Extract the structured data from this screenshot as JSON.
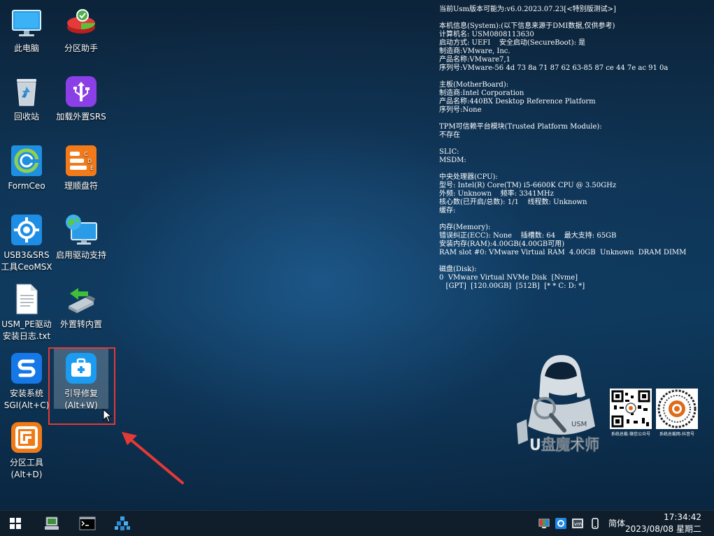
{
  "desktop": {
    "icons": [
      {
        "label1": "此电脑",
        "label2": ""
      },
      {
        "label1": "分区助手",
        "label2": ""
      },
      {
        "label1": "回收站",
        "label2": ""
      },
      {
        "label1": "加载外置SRS",
        "label2": ""
      },
      {
        "label1": "FormCeo",
        "label2": ""
      },
      {
        "label1": "理顺盘符",
        "label2": ""
      },
      {
        "label1": "USB3&SRS",
        "label2": "工具CeoMSX"
      },
      {
        "label1": "启用驱动支持",
        "label2": ""
      },
      {
        "label1": "USM_PE驱动",
        "label2": "安装日志.txt"
      },
      {
        "label1": "外置转内置",
        "label2": ""
      },
      {
        "label1": "安装系统",
        "label2": "SGI(Alt+C)"
      },
      {
        "label1": "引导修复",
        "label2": "(Alt+W)"
      },
      {
        "label1": "分区工具",
        "label2": "(Alt+D)"
      }
    ],
    "selected_icon": "引导修复"
  },
  "sysinfo": {
    "lines": [
      "当前Usm版本可能为:v6.0.2023.07.23[<特别版测试>]",
      "",
      "本机信息(System):(以下信息来源于DMI数据,仅供参考)",
      "计算机名: USM0808113630",
      "启动方式: UEFI    安全启动(SecureBoot): 是",
      "制造商:VMware, Inc.",
      "产品名称:VMware7,1",
      "序列号:VMware-56 4d 73 8a 71 87 62 63-85 87 ce 44 7e ac 91 0a",
      "",
      "主板(MotherBoard):",
      "制造商:Intel Corporation",
      "产品名称:440BX Desktop Reference Platform",
      "序列号:None",
      "",
      "TPM可信赖平台模块(Trusted Platform Module):",
      "不存在",
      "",
      "SLIC:",
      "MSDM:",
      "",
      "中央处理器(CPU):",
      "型号: Intel(R) Core(TM) i5-6600K CPU @ 3.50GHz",
      "外频: Unknown    频率: 3341MHz",
      "核心数(已开启/总数): 1/1    线程数: Unknown",
      "缓存:",
      "",
      "内存(Memory):",
      "错误纠正(ECC): None    插槽数: 64    最大支持: 65GB",
      "安装内存(RAM):4.00GB(4.00GB可用)",
      "RAM slot #0: VMware Virtual RAM  4.00GB  Unknown  DRAM DIMM",
      "",
      "磁盘(Disk):",
      "0  VMware Virtual NVMe Disk  [Nvme]",
      "   [GPT]  [120.00GB]  [512B]  [* * C: D: *]"
    ]
  },
  "logo": {
    "brand_text": "U盘魔术师",
    "badge": "USM"
  },
  "qr_codes": [
    {
      "label": "系统总裁-微信公众号"
    },
    {
      "label": "系统总裁网-抖音号"
    }
  ],
  "taskbar": {
    "ime": "简体",
    "time": "17:34:42",
    "date": "2023/08/08 星期二"
  },
  "colors": {
    "highlight_box": "#e53935",
    "taskbar": "#101e2c",
    "text": "#ffffff"
  }
}
